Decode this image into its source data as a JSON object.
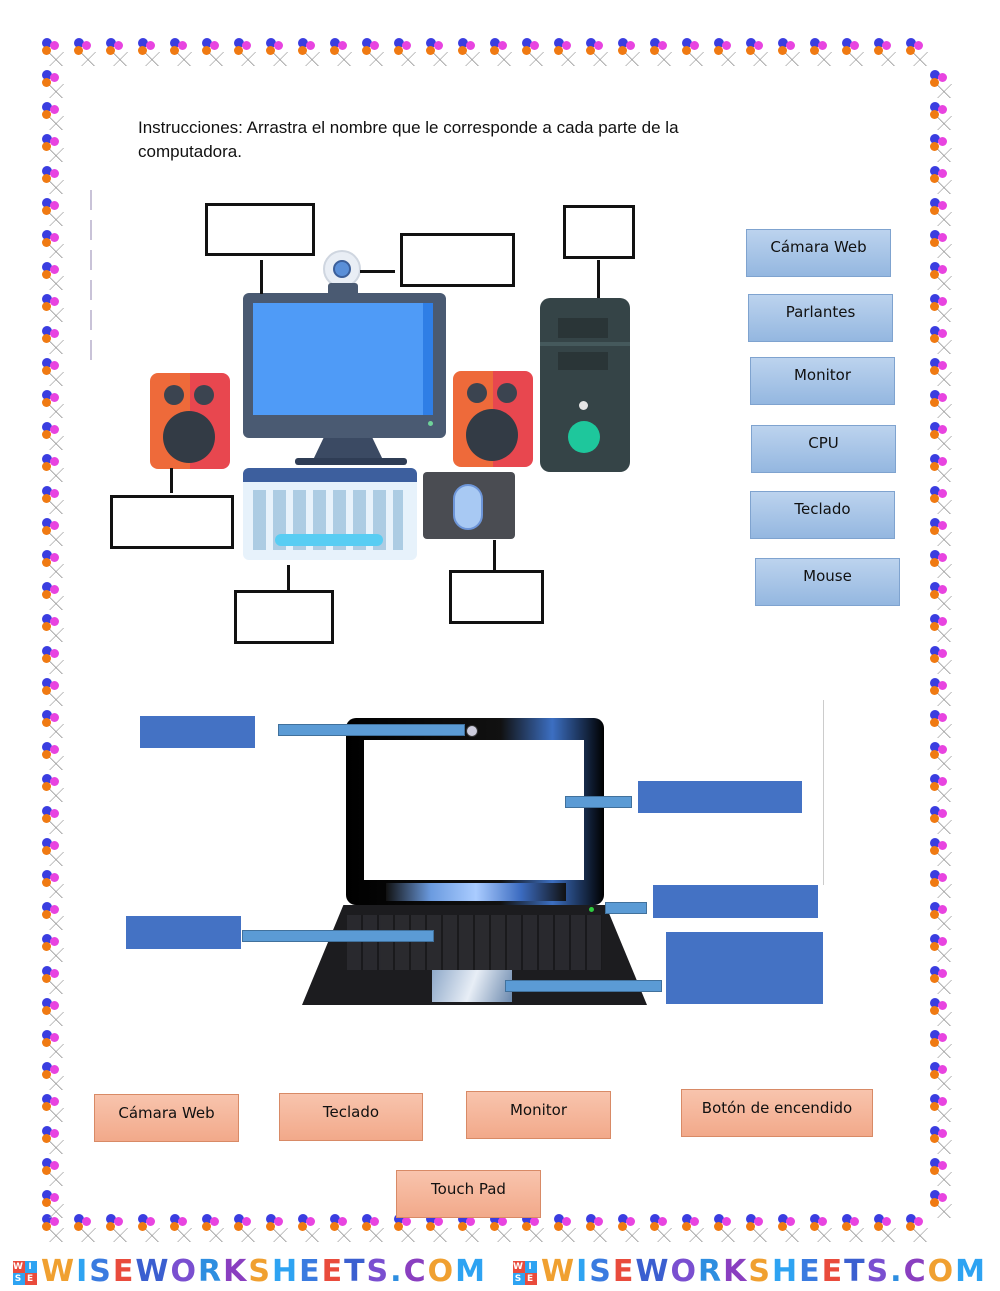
{
  "instructions": {
    "line1": "Instrucciones: Arrastra el nombre que le corresponde a cada parte de la",
    "line2": "computadora."
  },
  "desktop_section": {
    "image": "desktop-computer-illustration",
    "drop_targets": [
      "monitor-target",
      "webcam-target",
      "cpu-target",
      "speaker-target",
      "keyboard-target",
      "mouse-target"
    ],
    "labels": [
      "Cámara Web",
      "Parlantes",
      "Monitor",
      "CPU",
      "Teclado",
      "Mouse"
    ],
    "label_color": "#a9c5e8"
  },
  "laptop_section": {
    "image": "laptop-illustration",
    "drop_targets": [
      "webcam-target",
      "screen-target",
      "power-button-target",
      "keyboard-target",
      "touchpad-target"
    ],
    "drop_color": "#4472c4",
    "labels": [
      "Cámara Web",
      "Teclado",
      "Monitor",
      "Botón de encendido",
      "Touch Pad"
    ],
    "label_color": "#f5b59a"
  },
  "footer": {
    "brand": "WISEWORKSHEETS.COM",
    "logo_letters": [
      "W",
      "I",
      "S",
      "E"
    ]
  }
}
